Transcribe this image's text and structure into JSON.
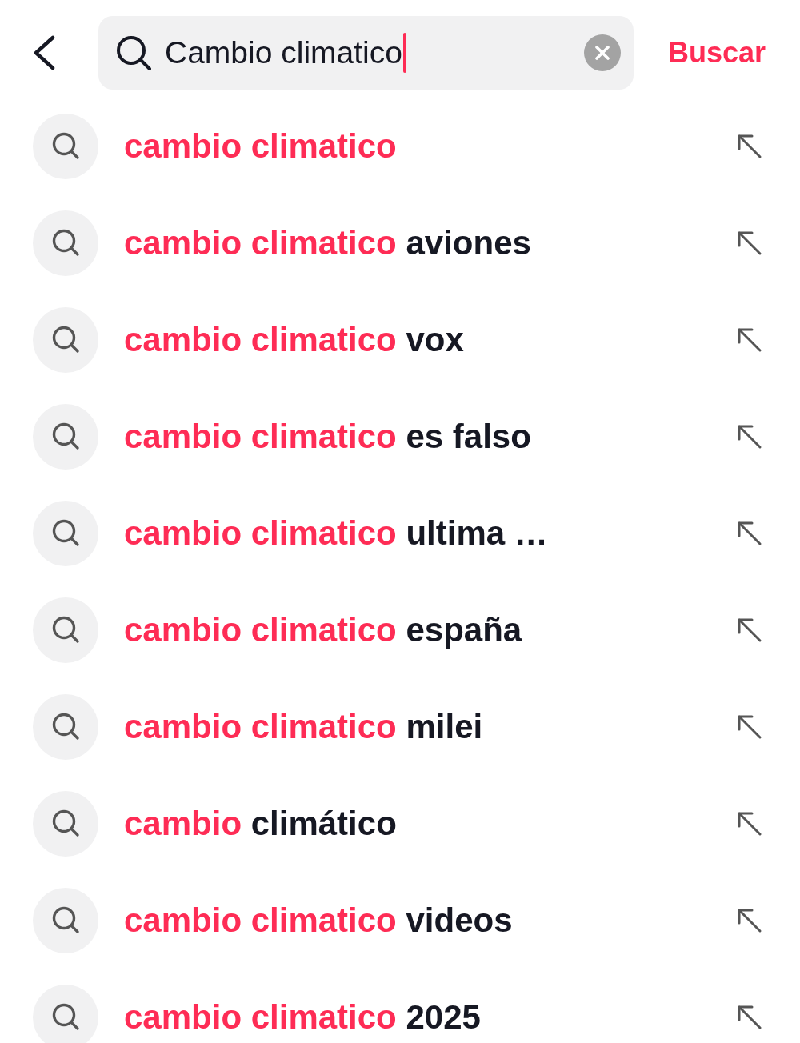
{
  "search": {
    "value": "Cambio climatico",
    "focused": true,
    "button": "Buscar"
  },
  "suggestions": [
    {
      "match": "cambio climatico"
    },
    {
      "match": "cambio climatico",
      "completion": "aviones"
    },
    {
      "match": "cambio climatico",
      "completion": "vox"
    },
    {
      "match": "cambio climatico",
      "completion": "es falso"
    },
    {
      "match": "cambio climatico",
      "completion": "ultima …"
    },
    {
      "match": "cambio climatico",
      "completion": "españa"
    },
    {
      "match": "cambio climatico",
      "completion": "milei"
    },
    {
      "match": "cambio",
      "completion": "climático"
    },
    {
      "match": "cambio climatico",
      "completion": "videos"
    },
    {
      "match": "cambio climatico",
      "completion": "2025"
    }
  ]
}
